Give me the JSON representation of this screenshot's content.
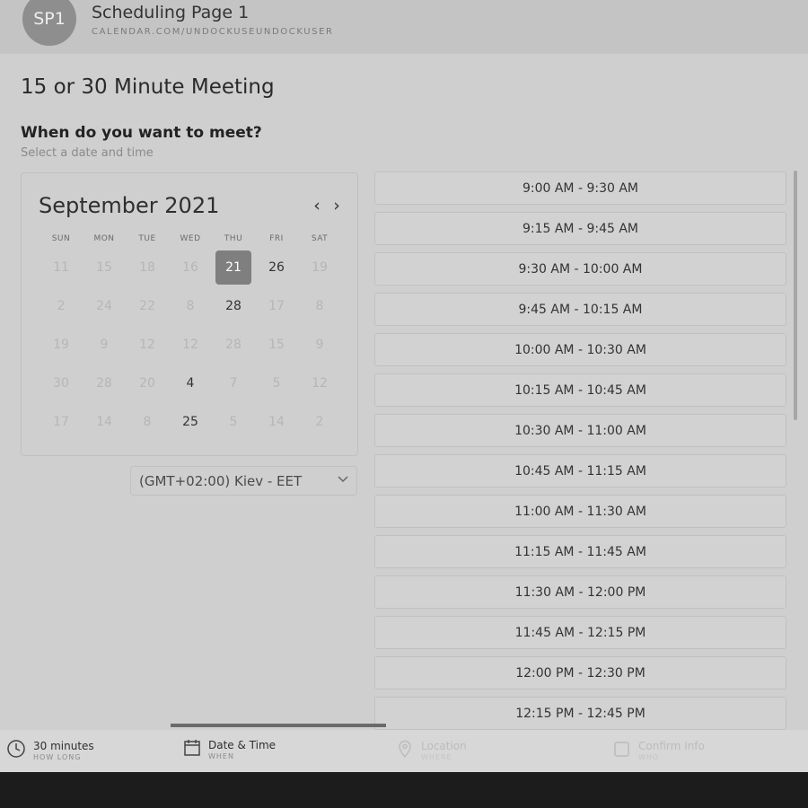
{
  "header": {
    "avatar_initials": "SP1",
    "page_name": "Scheduling Page 1",
    "page_url": "CALENDAR.COM/UNDOCKUSEUNDOCKUSER"
  },
  "meeting": {
    "title": "15 or 30 Minute Meeting",
    "question": "When do you want to meet?",
    "subtitle": "Select a date and time"
  },
  "calendar": {
    "month_label": "September 2021",
    "prev_icon": "chevron-left-icon",
    "next_icon": "chevron-right-icon",
    "weekdays": [
      "SUN",
      "MON",
      "TUE",
      "WED",
      "THU",
      "FRI",
      "SAT"
    ],
    "weeks": [
      [
        "11",
        "15",
        "18",
        "16",
        "21",
        "26",
        "19"
      ],
      [
        "2",
        "24",
        "22",
        "8",
        "28",
        "17",
        "8"
      ],
      [
        "19",
        "9",
        "12",
        "12",
        "28",
        "15",
        "9"
      ],
      [
        "30",
        "28",
        "20",
        "4",
        "7",
        "5",
        "12"
      ],
      [
        "17",
        "14",
        "8",
        "25",
        "5",
        "14",
        "2"
      ]
    ],
    "available_days": [
      "26",
      "28",
      "4",
      "25"
    ],
    "selected_day": "21"
  },
  "timezone": {
    "label": "(GMT+02:00) Kiev - EET",
    "chevron_icon": "chevron-down-icon"
  },
  "time_slots": [
    "9:00 AM - 9:30 AM",
    "9:15 AM - 9:45 AM",
    "9:30 AM - 10:00 AM",
    "9:45 AM - 10:15 AM",
    "10:00 AM - 10:30 AM",
    "10:15 AM - 10:45 AM",
    "10:30 AM - 11:00 AM",
    "10:45 AM - 11:15 AM",
    "11:00 AM - 11:30 AM",
    "11:15 AM - 11:45 AM",
    "11:30 AM - 12:00 PM",
    "11:45 AM - 12:15 PM",
    "12:00 PM - 12:30 PM",
    "12:15 PM - 12:45 PM"
  ],
  "footer": {
    "steps": [
      {
        "label": "30 minutes",
        "sub": "HOW LONG",
        "icon": "clock-icon"
      },
      {
        "label": "Date & Time",
        "sub": "WHEN",
        "icon": "calendar-icon"
      },
      {
        "label": "Location",
        "sub": "WHERE",
        "icon": "location-pin-icon"
      },
      {
        "label": "Confirm Info",
        "sub": "WHO",
        "icon": "checkbox-icon"
      }
    ]
  },
  "colors": {
    "background": "#cfcfcf",
    "header": "#c4c4c4",
    "selected_day": "#7f7f7f",
    "dark_band": "#1c1c1c"
  }
}
